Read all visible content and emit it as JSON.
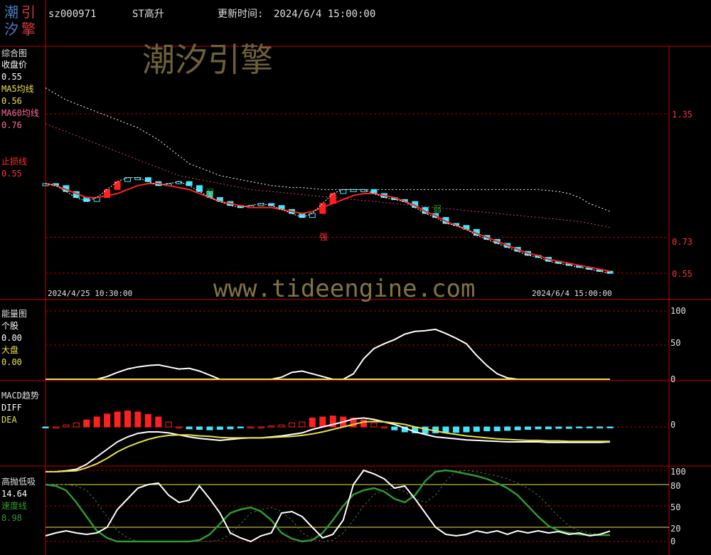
{
  "header": {
    "logo_chars": [
      "潮",
      "引",
      "汐",
      "擎"
    ],
    "stock_code": "sz000971",
    "stock_name": "ST高升",
    "update_label": "更新时间:",
    "update_time": "2024/6/4 15:00:00"
  },
  "watermark": {
    "brand": "潮汐引擎",
    "url": "www.tideengine.com"
  },
  "colors": {
    "background": "#000000",
    "panel_border": "#c00000",
    "close": "#ffffff",
    "ma5": "#e8e04a",
    "ma60": "#ff5050",
    "stoploss": "#ff3030",
    "cyan": "#40e8ff",
    "red": "#ff2020",
    "green": "#2e9a2e"
  },
  "panel_main": {
    "title": "综合图",
    "legend": [
      {
        "label": "收盘价",
        "value": "0.55",
        "color": "#ffffff"
      },
      {
        "label": "MA5均线",
        "value": "0.56",
        "color": "#e8e04a"
      },
      {
        "label": "MA60均线",
        "value": "0.76",
        "color": "#ff5050"
      },
      {
        "label": "止损线",
        "value": "0.55",
        "color": "#ff3030"
      }
    ],
    "y_ticks": [
      "1.35",
      "0.73",
      "0.55"
    ],
    "date_start": "2024/4/25 10:30:00",
    "date_end": "2024/6/4 15:00:00",
    "annotations": [
      {
        "text": "弱",
        "color": "#2e9a2e"
      },
      {
        "text": "强",
        "color": "#ff3030"
      },
      {
        "text": "弱",
        "color": "#2e9a2e"
      }
    ]
  },
  "panel_energy": {
    "title": "能量图",
    "legend": [
      {
        "label": "个股",
        "value": "0.00",
        "color": "#ffffff"
      },
      {
        "label": "大盘",
        "value": "0.00",
        "color": "#e8e04a"
      }
    ],
    "y_ticks": [
      "100",
      "50",
      "0"
    ]
  },
  "panel_macd": {
    "title": "MACD趋势",
    "legend": [
      {
        "label": "DIFF",
        "color": "#ffffff"
      },
      {
        "label": "DEA",
        "color": "#e8e04a"
      }
    ],
    "y_ticks": [
      "0"
    ]
  },
  "panel_osc": {
    "title": "高抛低吸",
    "legend": [
      {
        "value": "14.64",
        "color": "#ffffff"
      },
      {
        "label": "速度线",
        "value": "8.98",
        "color": "#2e9a2e"
      }
    ],
    "y_ticks": [
      "100",
      "80",
      "50",
      "20",
      "0"
    ]
  },
  "chart_data": {
    "type": "line",
    "stock": "sz000971",
    "x_start": "2024/4/25 10:30:00",
    "x_end": "2024/6/4 15:00:00",
    "main": {
      "y_ticks": [
        1.35,
        0.73,
        0.55
      ],
      "close_last": 0.55,
      "ma5_last": 0.56,
      "ma60_last": 0.76,
      "stoploss_last": 0.55,
      "close": [
        1.0,
        0.99,
        0.96,
        0.93,
        0.91,
        0.93,
        0.97,
        1.01,
        1.03,
        1.03,
        1.01,
        0.99,
        1.0,
        1.01,
        0.99,
        0.96,
        0.93,
        0.91,
        0.89,
        0.88,
        0.89,
        0.9,
        0.89,
        0.87,
        0.85,
        0.83,
        0.85,
        0.9,
        0.95,
        0.97,
        0.97,
        0.97,
        0.95,
        0.93,
        0.92,
        0.91,
        0.88,
        0.85,
        0.83,
        0.8,
        0.79,
        0.77,
        0.74,
        0.72,
        0.7,
        0.68,
        0.66,
        0.64,
        0.63,
        0.61,
        0.6,
        0.59,
        0.58,
        0.57,
        0.56,
        0.55
      ],
      "ma5": [
        1.0,
        0.99,
        0.97,
        0.95,
        0.93,
        0.93,
        0.94,
        0.95,
        0.97,
        0.99,
        1.0,
        1.0,
        0.99,
        0.98,
        0.97,
        0.95,
        0.93,
        0.91,
        0.9,
        0.89,
        0.88,
        0.88,
        0.88,
        0.87,
        0.86,
        0.85,
        0.86,
        0.88,
        0.9,
        0.92,
        0.94,
        0.95,
        0.95,
        0.94,
        0.93,
        0.91,
        0.89,
        0.86,
        0.84,
        0.81,
        0.79,
        0.77,
        0.75,
        0.73,
        0.71,
        0.69,
        0.67,
        0.65,
        0.64,
        0.62,
        0.61,
        0.6,
        0.59,
        0.58,
        0.57,
        0.56
      ],
      "ma60": [
        1.3,
        1.28,
        1.26,
        1.24,
        1.22,
        1.2,
        1.18,
        1.16,
        1.14,
        1.12,
        1.1,
        1.08,
        1.06,
        1.04,
        1.03,
        1.02,
        1.01,
        1.0,
        0.99,
        0.98,
        0.97,
        0.965,
        0.96,
        0.955,
        0.95,
        0.945,
        0.94,
        0.935,
        0.93,
        0.925,
        0.92,
        0.915,
        0.91,
        0.905,
        0.9,
        0.895,
        0.89,
        0.885,
        0.88,
        0.875,
        0.87,
        0.865,
        0.86,
        0.855,
        0.85,
        0.845,
        0.84,
        0.835,
        0.83,
        0.825,
        0.82,
        0.815,
        0.81,
        0.8,
        0.79,
        0.78
      ],
      "upper_band": [
        1.48,
        1.45,
        1.42,
        1.4,
        1.38,
        1.36,
        1.34,
        1.32,
        1.3,
        1.28,
        1.25,
        1.22,
        1.18,
        1.14,
        1.1,
        1.08,
        1.06,
        1.04,
        1.03,
        1.02,
        1.01,
        1.0,
        0.99,
        0.985,
        0.98,
        0.98,
        0.975,
        0.97,
        0.97,
        0.97,
        0.97,
        0.97,
        0.97,
        0.97,
        0.97,
        0.97,
        0.97,
        0.97,
        0.97,
        0.97,
        0.97,
        0.97,
        0.97,
        0.97,
        0.97,
        0.97,
        0.97,
        0.97,
        0.97,
        0.965,
        0.96,
        0.95,
        0.93,
        0.9,
        0.88,
        0.86
      ]
    },
    "energy": {
      "y_ticks": [
        0,
        50,
        100
      ],
      "stock_last": 0.0,
      "market_last": 0.0,
      "stock": [
        0,
        0,
        0,
        0,
        0,
        0,
        4,
        10,
        15,
        18,
        20,
        21,
        18,
        15,
        16,
        12,
        6,
        0,
        0,
        0,
        0,
        0,
        0,
        3,
        10,
        12,
        8,
        4,
        0,
        0,
        8,
        30,
        45,
        52,
        58,
        66,
        70,
        71,
        73,
        67,
        60,
        52,
        35,
        20,
        8,
        2,
        0,
        0,
        0,
        0,
        0,
        0,
        0,
        0,
        0,
        0
      ],
      "market": [
        0,
        0,
        0,
        0,
        0,
        0,
        0,
        0,
        0,
        0,
        0,
        0,
        0,
        0,
        0,
        0,
        0,
        0,
        0,
        0,
        0,
        0,
        0,
        0,
        0,
        0,
        0,
        0,
        0,
        0,
        0,
        0,
        0,
        0,
        0,
        0,
        0,
        0,
        0,
        0,
        0,
        0,
        0,
        0,
        0,
        0,
        0,
        0,
        0,
        0,
        0,
        0,
        0,
        0,
        0,
        0
      ]
    },
    "macd": {
      "y_ticks": [
        0
      ],
      "diff": [
        -0.09,
        -0.09,
        -0.088,
        -0.085,
        -0.075,
        -0.06,
        -0.045,
        -0.03,
        -0.02,
        -0.013,
        -0.01,
        -0.01,
        -0.012,
        -0.016,
        -0.02,
        -0.023,
        -0.025,
        -0.027,
        -0.025,
        -0.023,
        -0.022,
        -0.022,
        -0.02,
        -0.018,
        -0.015,
        -0.012,
        -0.005,
        0.0,
        0.005,
        0.01,
        0.016,
        0.018,
        0.015,
        0.01,
        0.005,
        -0.002,
        -0.01,
        -0.015,
        -0.02,
        -0.022,
        -0.024,
        -0.026,
        -0.027,
        -0.028,
        -0.029,
        -0.03,
        -0.03,
        -0.03,
        -0.03,
        -0.031,
        -0.031,
        -0.031,
        -0.031,
        -0.031,
        -0.031,
        -0.03
      ],
      "dea": [
        -0.09,
        -0.09,
        -0.089,
        -0.088,
        -0.082,
        -0.074,
        -0.063,
        -0.05,
        -0.04,
        -0.032,
        -0.025,
        -0.02,
        -0.017,
        -0.016,
        -0.016,
        -0.018,
        -0.019,
        -0.021,
        -0.022,
        -0.022,
        -0.022,
        -0.022,
        -0.021,
        -0.02,
        -0.019,
        -0.017,
        -0.014,
        -0.01,
        -0.005,
        0.0,
        0.005,
        0.01,
        0.011,
        0.01,
        0.008,
        0.005,
        0.0,
        -0.004,
        -0.008,
        -0.012,
        -0.015,
        -0.018,
        -0.02,
        -0.022,
        -0.024,
        -0.025,
        -0.026,
        -0.027,
        -0.027,
        -0.028,
        -0.028,
        -0.029,
        -0.029,
        -0.029,
        -0.029,
        -0.029
      ],
      "histogram": [
        -0.001,
        0,
        0.004,
        0.008,
        0.014,
        0.02,
        0.026,
        0.03,
        0.032,
        0.03,
        0.025,
        0.02,
        0.01,
        0.0,
        -0.004,
        -0.005,
        -0.006,
        -0.005,
        -0.004,
        -0.002,
        0,
        0,
        0.002,
        0.004,
        0.008,
        0.01,
        0.018,
        0.02,
        0.022,
        0.02,
        0.018,
        0.014,
        0.008,
        0.0,
        -0.006,
        -0.01,
        -0.012,
        -0.013,
        -0.012,
        -0.012,
        -0.011,
        -0.01,
        -0.009,
        -0.008,
        -0.008,
        -0.007,
        -0.006,
        -0.005,
        -0.004,
        -0.004,
        -0.003,
        -0.003,
        -0.002,
        -0.002,
        -0.002,
        -0.002
      ]
    },
    "oscillator": {
      "y_ticks": [
        0,
        20,
        50,
        80,
        100
      ],
      "white_last": 14.64,
      "speed_last": 8.98,
      "white": [
        8,
        12,
        15,
        12,
        10,
        12,
        20,
        45,
        60,
        75,
        80,
        82,
        65,
        55,
        58,
        78,
        60,
        40,
        12,
        5,
        0,
        8,
        12,
        40,
        42,
        35,
        20,
        5,
        10,
        30,
        80,
        100,
        95,
        88,
        75,
        78,
        60,
        40,
        20,
        10,
        8,
        10,
        15,
        12,
        15,
        10,
        15,
        12,
        15,
        12,
        14,
        10,
        12,
        8,
        10,
        14.64
      ],
      "speed": [
        80,
        78,
        72,
        55,
        35,
        15,
        5,
        0,
        0,
        0,
        0,
        0,
        0,
        0,
        0,
        2,
        10,
        25,
        40,
        45,
        48,
        42,
        30,
        12,
        4,
        0,
        2,
        12,
        30,
        50,
        66,
        72,
        75,
        70,
        60,
        55,
        65,
        85,
        98,
        100,
        98,
        95,
        92,
        88,
        82,
        75,
        65,
        50,
        35,
        22,
        15,
        12,
        10,
        9,
        9,
        8.98
      ]
    }
  }
}
